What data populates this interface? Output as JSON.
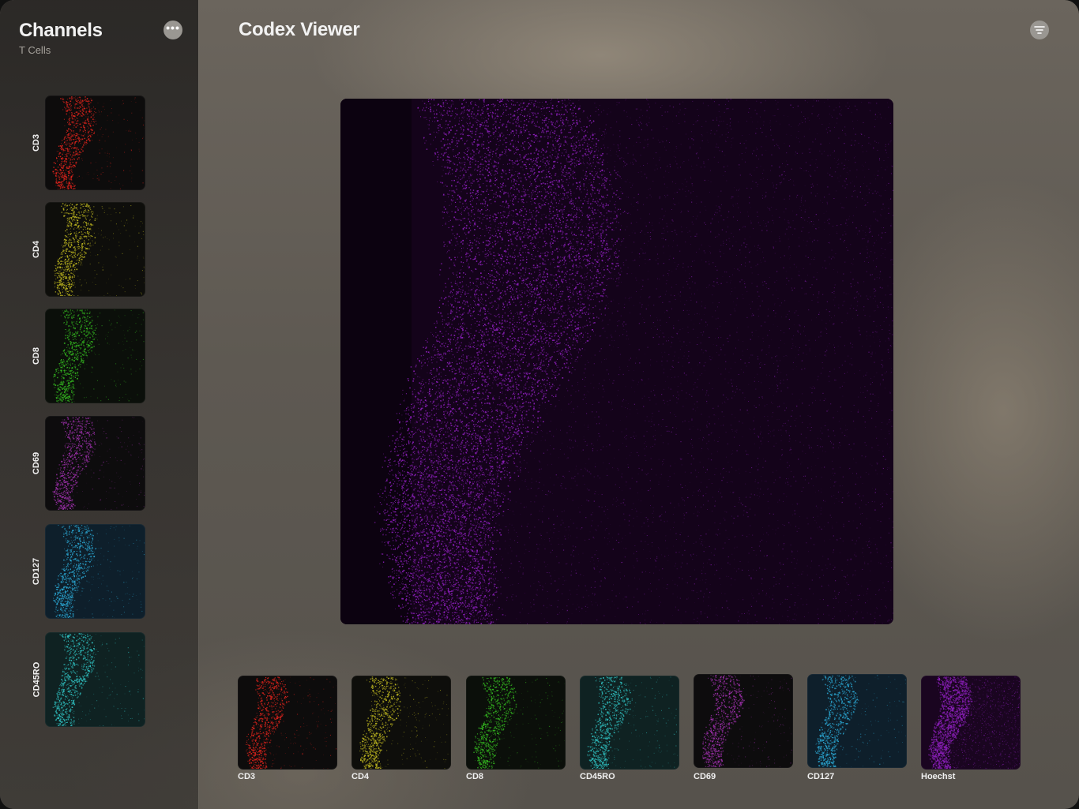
{
  "sidebar": {
    "title": "Channels",
    "subtitle": "T Cells",
    "more_icon": "ellipsis-circle-icon",
    "items": [
      {
        "label": "CD3",
        "color": "#d8231c",
        "background": "#0d0c0c"
      },
      {
        "label": "CD4",
        "color": "#b9b21f",
        "background": "#0e0e0b"
      },
      {
        "label": "CD8",
        "color": "#33b31f",
        "background": "#0b0f0a"
      },
      {
        "label": "CD69",
        "color": "#9b2fa8",
        "background": "#0d0c0d"
      },
      {
        "label": "CD127",
        "color": "#2aa4cf",
        "background": "#0e1f2b"
      },
      {
        "label": "CD45RO",
        "color": "#2fbfbf",
        "background": "#0f2222"
      }
    ]
  },
  "main": {
    "title": "Codex Viewer",
    "filter_icon": "filter-lines-icon",
    "viewer": {
      "channel": "Hoechst",
      "color": "#8a1fb8",
      "background": "#14031a"
    }
  },
  "bottom_strip": {
    "items": [
      {
        "label": "CD3",
        "color": "#d8231c",
        "background": "#0d0c0c"
      },
      {
        "label": "CD4",
        "color": "#b9b21f",
        "background": "#0e0e0b"
      },
      {
        "label": "CD8",
        "color": "#33b31f",
        "background": "#0b0f0a"
      },
      {
        "label": "CD45RO",
        "color": "#2fbfbf",
        "background": "#0f2222"
      },
      {
        "label": "CD69",
        "color": "#9b2fa8",
        "background": "#0d0c0d"
      },
      {
        "label": "CD127",
        "color": "#2aa4cf",
        "background": "#0e1f2b"
      },
      {
        "label": "Hoechst",
        "color": "#8a1fb8",
        "background": "#1a0520"
      }
    ]
  }
}
